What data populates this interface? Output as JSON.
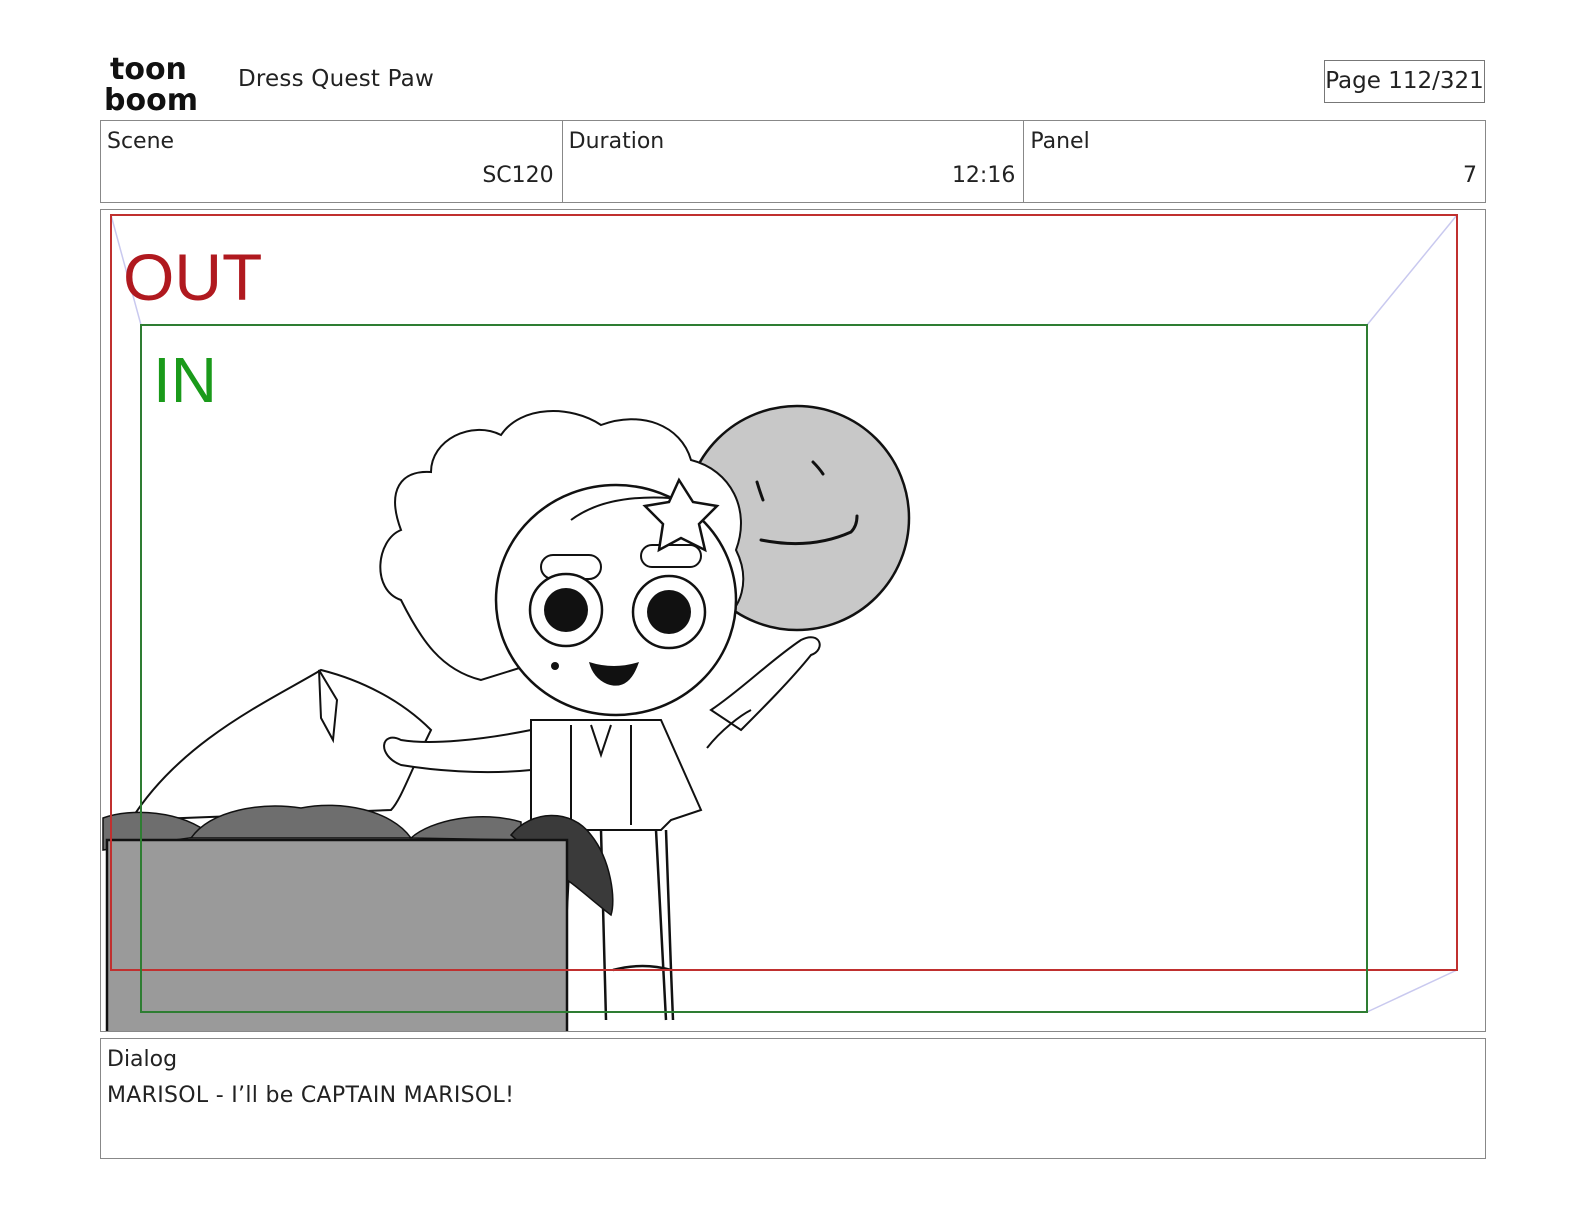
{
  "header": {
    "logo": {
      "top_text": "toon",
      "bottom_text": "boom",
      "icon": "toon-boom-logo"
    },
    "project_title": "Dress Quest Paw",
    "page_label": "Page 112/321"
  },
  "info": {
    "scene_label": "Scene",
    "scene_value": "SC120",
    "duration_label": "Duration",
    "duration_value": "12:16",
    "panel_label": "Panel",
    "panel_value": "7"
  },
  "panel": {
    "out_label": "OUT",
    "in_label": "IN",
    "out_color": "#b0191f",
    "in_color": "#1a9a1a"
  },
  "dialog": {
    "label": "Dialog",
    "text": "MARISOL - I’ll be CAPTAIN MARISOL!"
  }
}
